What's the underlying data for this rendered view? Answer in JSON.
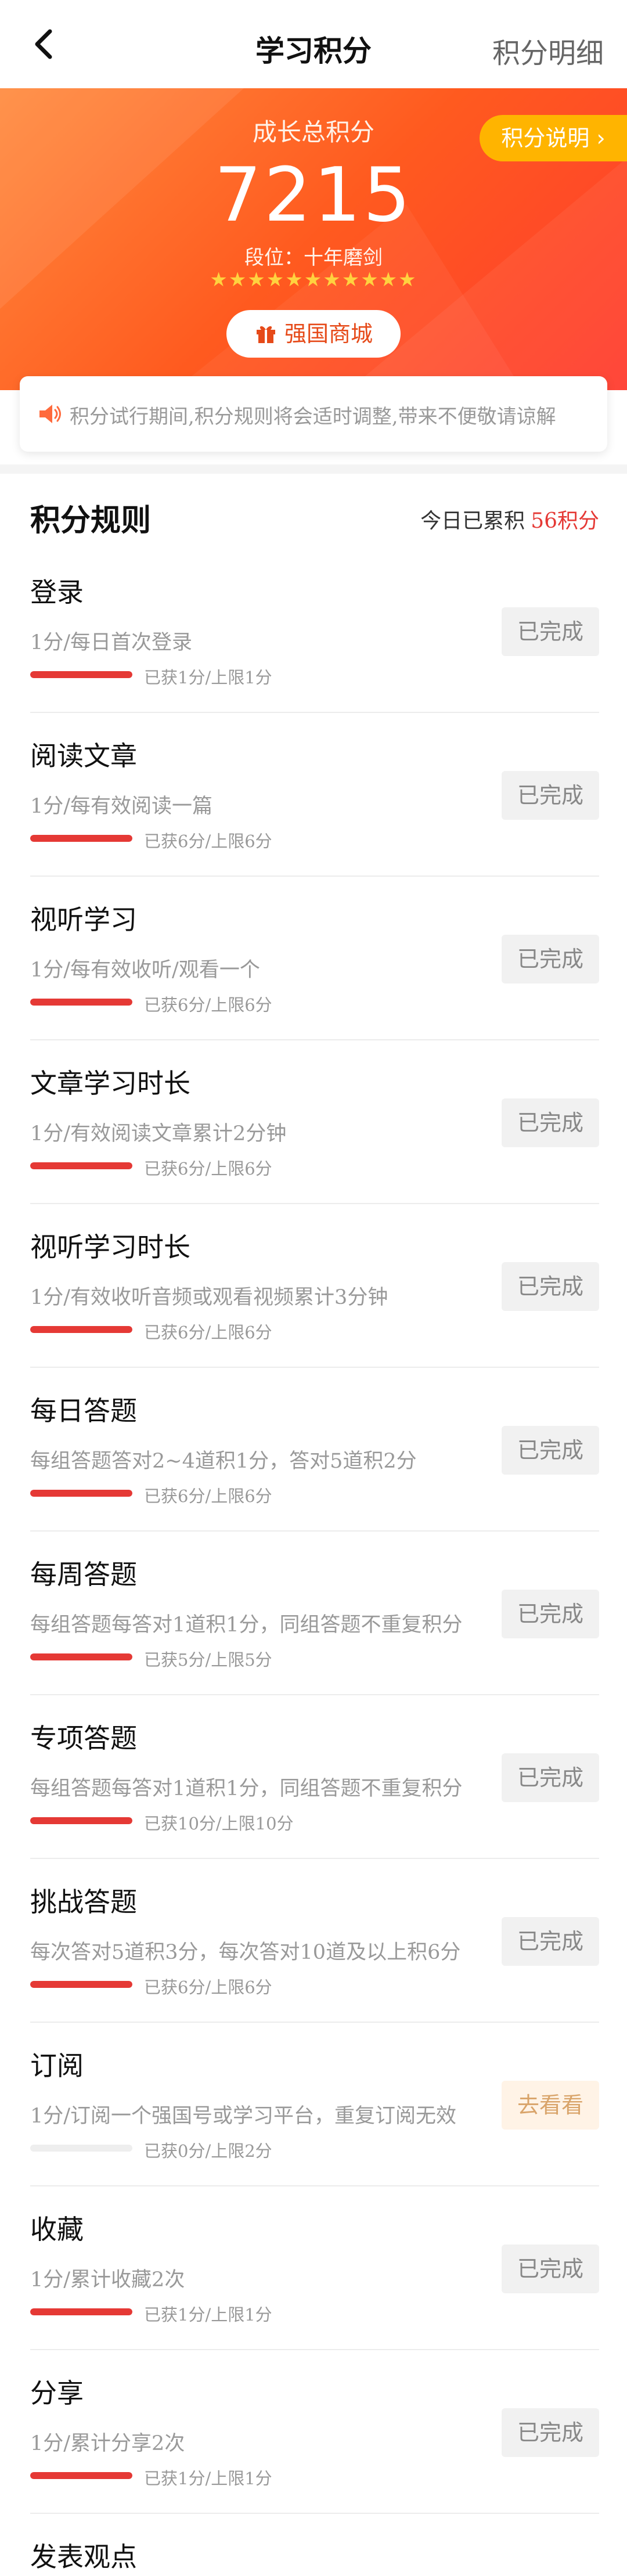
{
  "nav": {
    "title": "学习积分",
    "detail_link": "积分明细"
  },
  "hero": {
    "label": "成长总积分",
    "score": "7215",
    "rank": "段位：十年磨剑",
    "stars": "★★★★★★★★★★★",
    "info_button": "积分说明 ›",
    "shop_button": "强国商城"
  },
  "notice": {
    "text": "积分试行期间,积分规则将会适时调整,带来不便敬请谅解"
  },
  "rules": {
    "title": "积分规则",
    "today_label": "今日已累积",
    "today_points": "56积分",
    "items": [
      {
        "name": "登录",
        "desc": "1分/每日首次登录",
        "progress": "已获1分/上限1分",
        "ratio": 1.0,
        "button": "已完成",
        "status": "done"
      },
      {
        "name": "阅读文章",
        "desc": "1分/每有效阅读一篇",
        "progress": "已获6分/上限6分",
        "ratio": 1.0,
        "button": "已完成",
        "status": "done"
      },
      {
        "name": "视听学习",
        "desc": "1分/每有效收听/观看一个",
        "progress": "已获6分/上限6分",
        "ratio": 1.0,
        "button": "已完成",
        "status": "done"
      },
      {
        "name": "文章学习时长",
        "desc": "1分/有效阅读文章累计2分钟",
        "progress": "已获6分/上限6分",
        "ratio": 1.0,
        "button": "已完成",
        "status": "done"
      },
      {
        "name": "视听学习时长",
        "desc": "1分/有效收听音频或观看视频累计3分钟",
        "progress": "已获6分/上限6分",
        "ratio": 1.0,
        "button": "已完成",
        "status": "done"
      },
      {
        "name": "每日答题",
        "desc": "每组答题答对2~4道积1分，答对5道积2分",
        "progress": "已获6分/上限6分",
        "ratio": 1.0,
        "button": "已完成",
        "status": "done"
      },
      {
        "name": "每周答题",
        "desc": "每组答题每答对1道积1分，同组答题不重复积分",
        "progress": "已获5分/上限5分",
        "ratio": 1.0,
        "button": "已完成",
        "status": "done"
      },
      {
        "name": "专项答题",
        "desc": "每组答题每答对1道积1分，同组答题不重复积分",
        "progress": "已获10分/上限10分",
        "ratio": 1.0,
        "button": "已完成",
        "status": "done"
      },
      {
        "name": "挑战答题",
        "desc": "每次答对5道积3分，每次答对10道及以上积6分",
        "progress": "已获6分/上限6分",
        "ratio": 1.0,
        "button": "已完成",
        "status": "done"
      },
      {
        "name": "订阅",
        "desc": "1分/订阅一个强国号或学习平台，重复订阅无效",
        "progress": "已获0分/上限2分",
        "ratio": 0.0,
        "button": "去看看",
        "status": "todo"
      },
      {
        "name": "收藏",
        "desc": "1分/累计收藏2次",
        "progress": "已获1分/上限1分",
        "ratio": 1.0,
        "button": "已完成",
        "status": "done"
      },
      {
        "name": "分享",
        "desc": "1分/累计分享2次",
        "progress": "已获1分/上限1分",
        "ratio": 1.0,
        "button": "已完成",
        "status": "done"
      },
      {
        "name": "发表观点",
        "desc": "",
        "progress": "",
        "ratio": 0.0,
        "button": "",
        "status": "partial"
      }
    ]
  },
  "colors": {
    "accent_red": "#e53935",
    "hero_orange": "#ff5a1f",
    "info_yellow": "#ffb400",
    "star_yellow": "#ffd23f"
  },
  "icons": {
    "back": "chevron-left-icon",
    "gift": "gift-icon",
    "speaker": "speaker-icon"
  }
}
